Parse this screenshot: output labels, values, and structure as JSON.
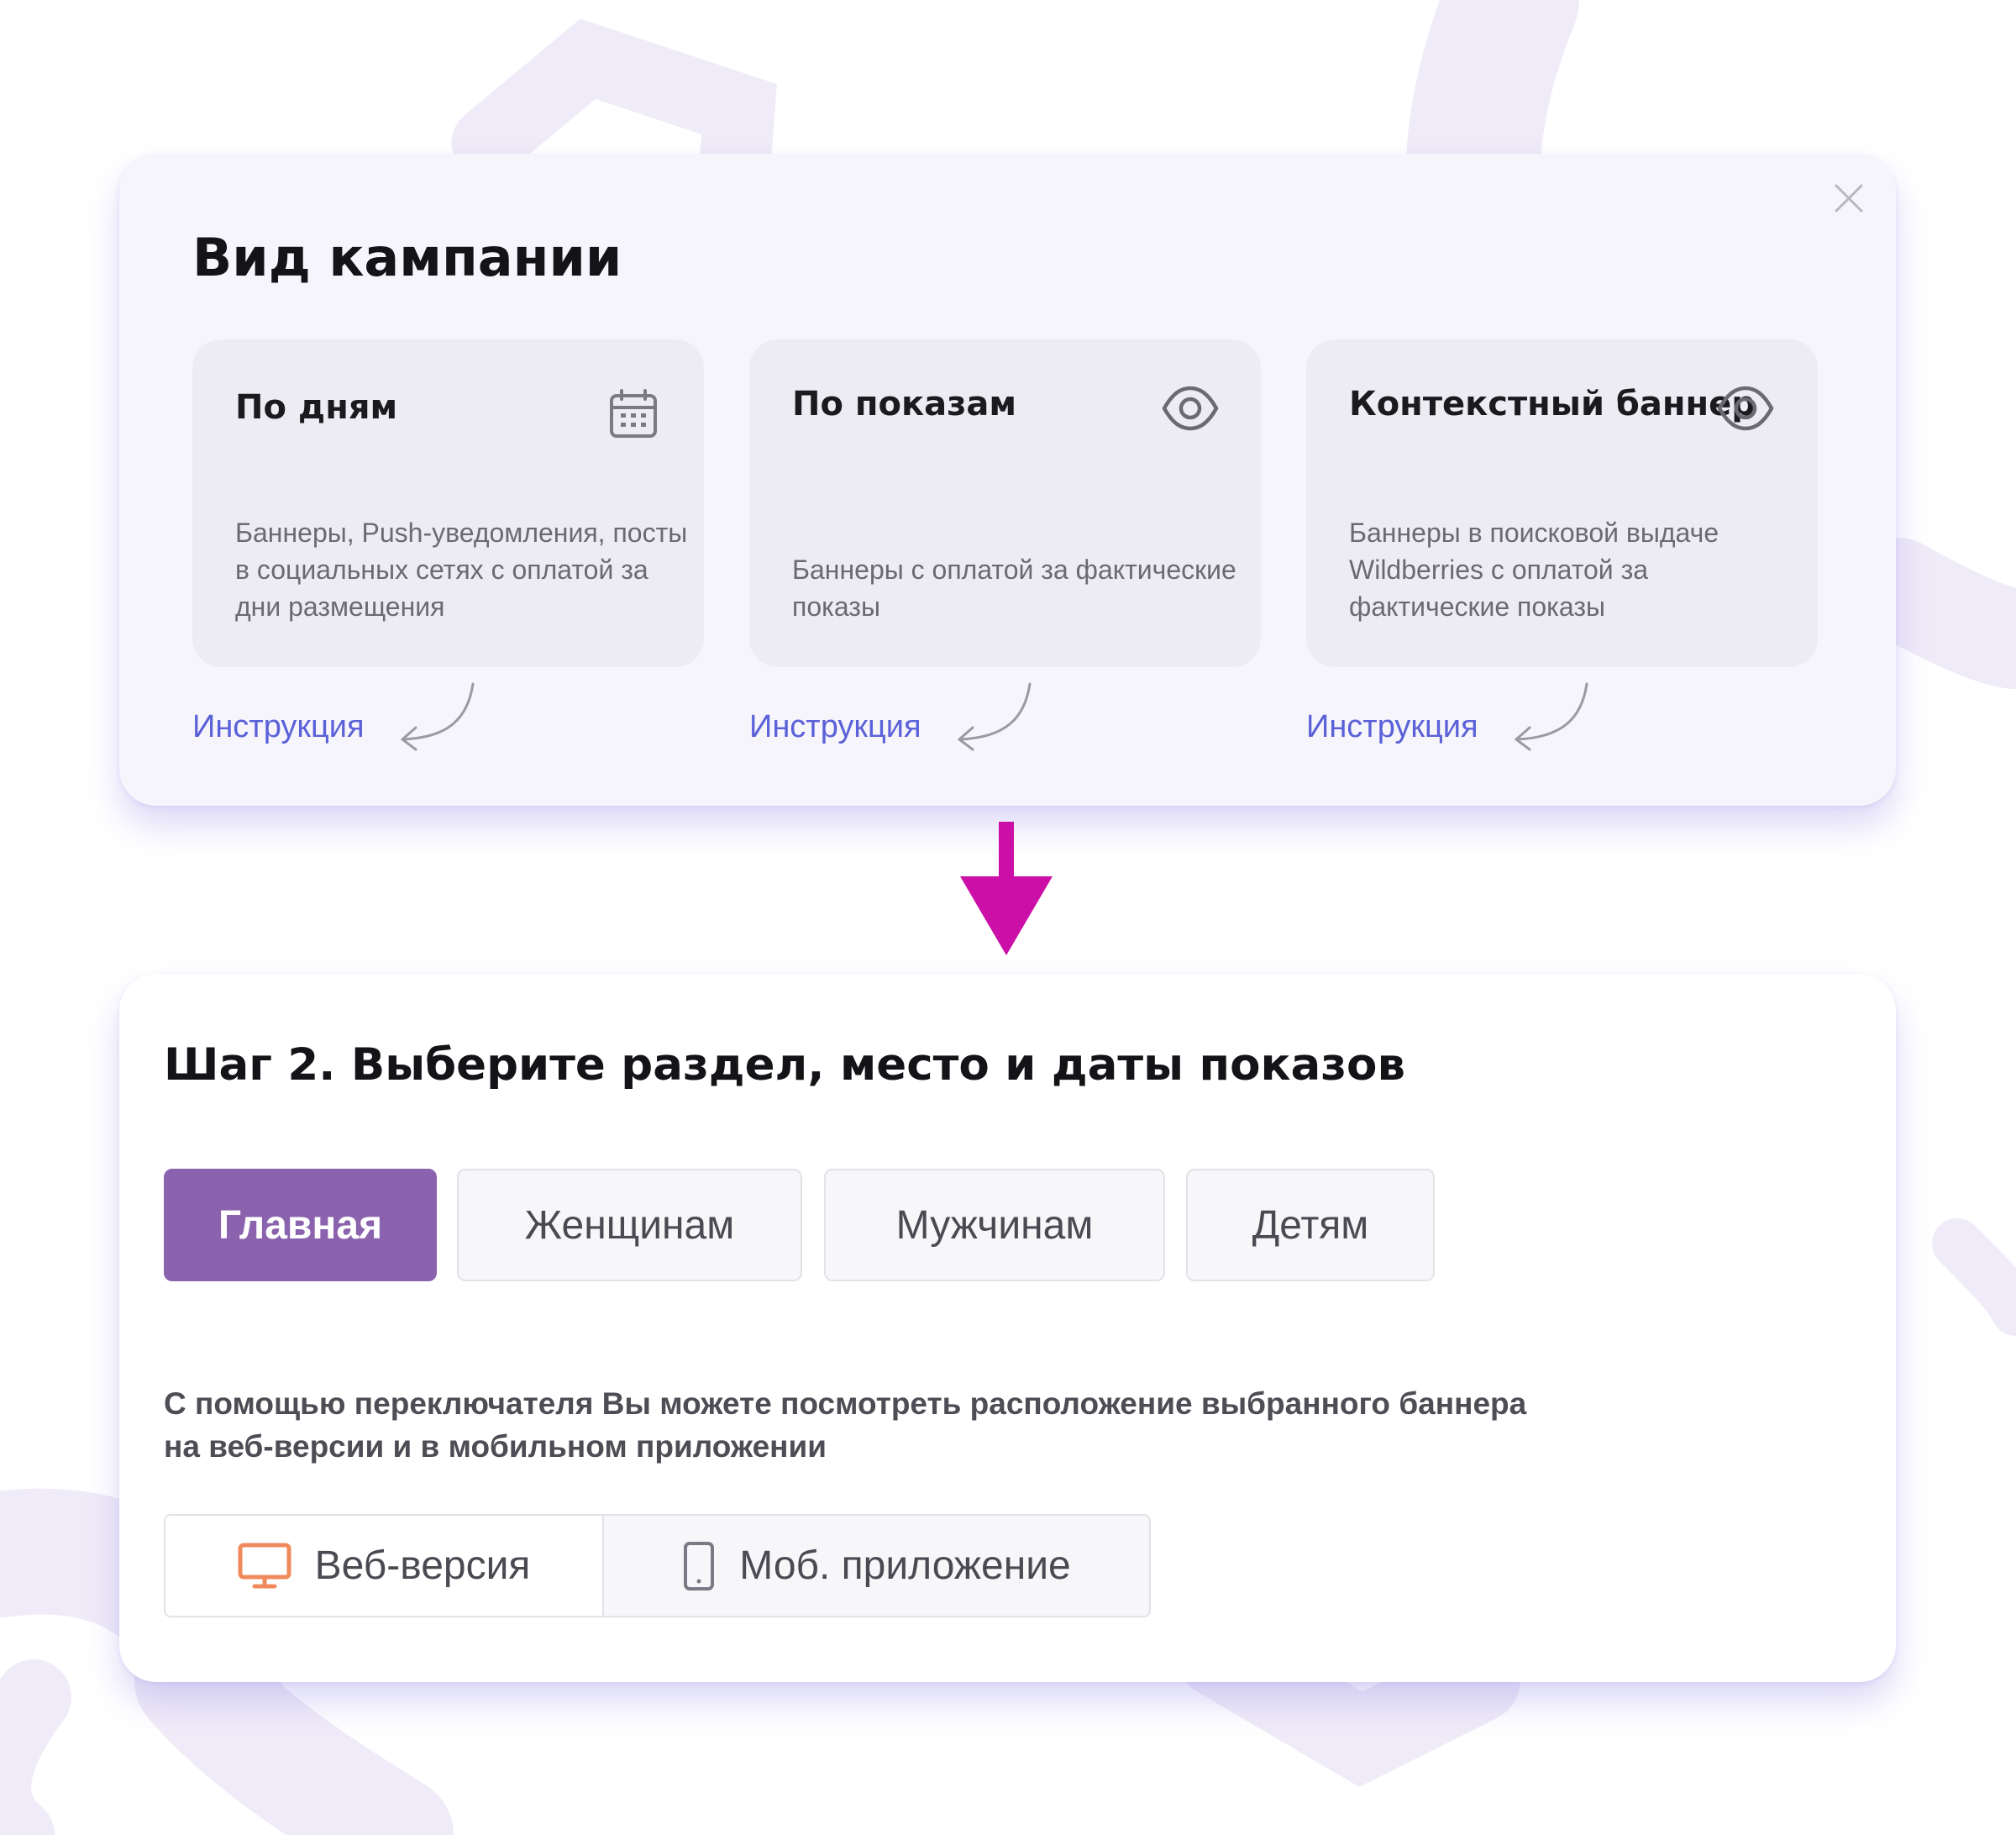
{
  "campaign_panel": {
    "title": "Вид кампании",
    "close_icon": "close-icon",
    "cards": [
      {
        "title": "По дням",
        "icon": "calendar-icon",
        "description": "Баннеры, Push-уведомления, посты в социальных сетях с оплатой за дни размещения"
      },
      {
        "title": "По показам",
        "icon": "eye-icon",
        "description": "Баннеры с оплатой за фактические показы"
      },
      {
        "title": "Контекстный баннер",
        "icon": "eye-icon",
        "description": "Баннеры в поисковой выдаче Wildberries с оплатой за фактические показы"
      }
    ],
    "instruction_links": [
      "Инструкция",
      "Инструкция",
      "Инструкция"
    ]
  },
  "step_panel": {
    "title": "Шаг 2. Выберите раздел, место и даты показов",
    "tabs": [
      {
        "label": "Главная",
        "active": true
      },
      {
        "label": "Женщинам",
        "active": false
      },
      {
        "label": "Мужчинам",
        "active": false
      },
      {
        "label": "Детям",
        "active": false
      }
    ],
    "helper_text_line1": "С помощью переключателя Вы можете посмотреть расположение выбранного баннера",
    "helper_text_line2": "на веб-версии и в мобильном приложении",
    "view_toggle": [
      {
        "label": "Веб-версия",
        "icon": "monitor-icon",
        "selected": true
      },
      {
        "label": "Моб. приложение",
        "icon": "smartphone-icon",
        "selected": false
      }
    ]
  },
  "colors": {
    "accent_purple": "#8b62ae",
    "link_blue": "#5b61d8",
    "arrow_magenta": "#cc0fa6",
    "monitor_orange": "#f08a5d",
    "background_shape_lavender": "#efeaf8"
  }
}
